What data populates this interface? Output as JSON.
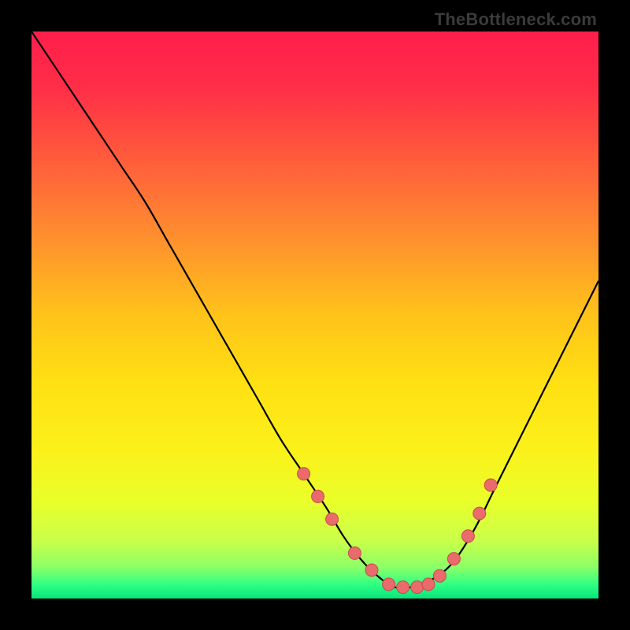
{
  "watermark": "TheBottleneck.com",
  "colors": {
    "page_bg": "#000000",
    "gradient_stops": [
      {
        "offset": 0.0,
        "color": "#ff1e4b"
      },
      {
        "offset": 0.1,
        "color": "#ff2e47"
      },
      {
        "offset": 0.22,
        "color": "#ff5a3c"
      },
      {
        "offset": 0.35,
        "color": "#ff8a30"
      },
      {
        "offset": 0.5,
        "color": "#ffc31a"
      },
      {
        "offset": 0.62,
        "color": "#ffe013"
      },
      {
        "offset": 0.74,
        "color": "#fbf11a"
      },
      {
        "offset": 0.83,
        "color": "#e9ff2b"
      },
      {
        "offset": 0.9,
        "color": "#c8ff4a"
      },
      {
        "offset": 0.945,
        "color": "#8bff68"
      },
      {
        "offset": 0.975,
        "color": "#31ff83"
      },
      {
        "offset": 1.0,
        "color": "#06e57c"
      }
    ],
    "curve_stroke": "#000000",
    "marker_fill": "#e96b6b",
    "marker_stroke": "#c94b4b"
  },
  "chart_data": {
    "type": "line",
    "title": "",
    "xlabel": "",
    "ylabel": "",
    "xlim": [
      0,
      100
    ],
    "ylim": [
      0,
      100
    ],
    "series": [
      {
        "name": "bottleneck-curve",
        "x": [
          0,
          4,
          8,
          12,
          16,
          20,
          24,
          28,
          32,
          36,
          40,
          44,
          48,
          52,
          55,
          58,
          61,
          64,
          67,
          70,
          74,
          78,
          82,
          86,
          90,
          94,
          98,
          100
        ],
        "y": [
          100,
          94,
          88,
          82,
          76,
          70,
          63,
          56,
          49,
          42,
          35,
          28,
          22,
          16,
          11,
          7,
          4,
          2,
          2,
          3,
          6,
          12,
          20,
          28,
          36,
          44,
          52,
          56
        ]
      }
    ],
    "markers": {
      "name": "highlight-points",
      "x": [
        48,
        50.5,
        53,
        57,
        60,
        63,
        65.5,
        68,
        70,
        72,
        74.5,
        77,
        79,
        81
      ],
      "y": [
        22,
        18,
        14,
        8,
        5,
        2.5,
        2,
        2,
        2.5,
        4,
        7,
        11,
        15,
        20
      ]
    },
    "legend": null,
    "grid": false
  }
}
